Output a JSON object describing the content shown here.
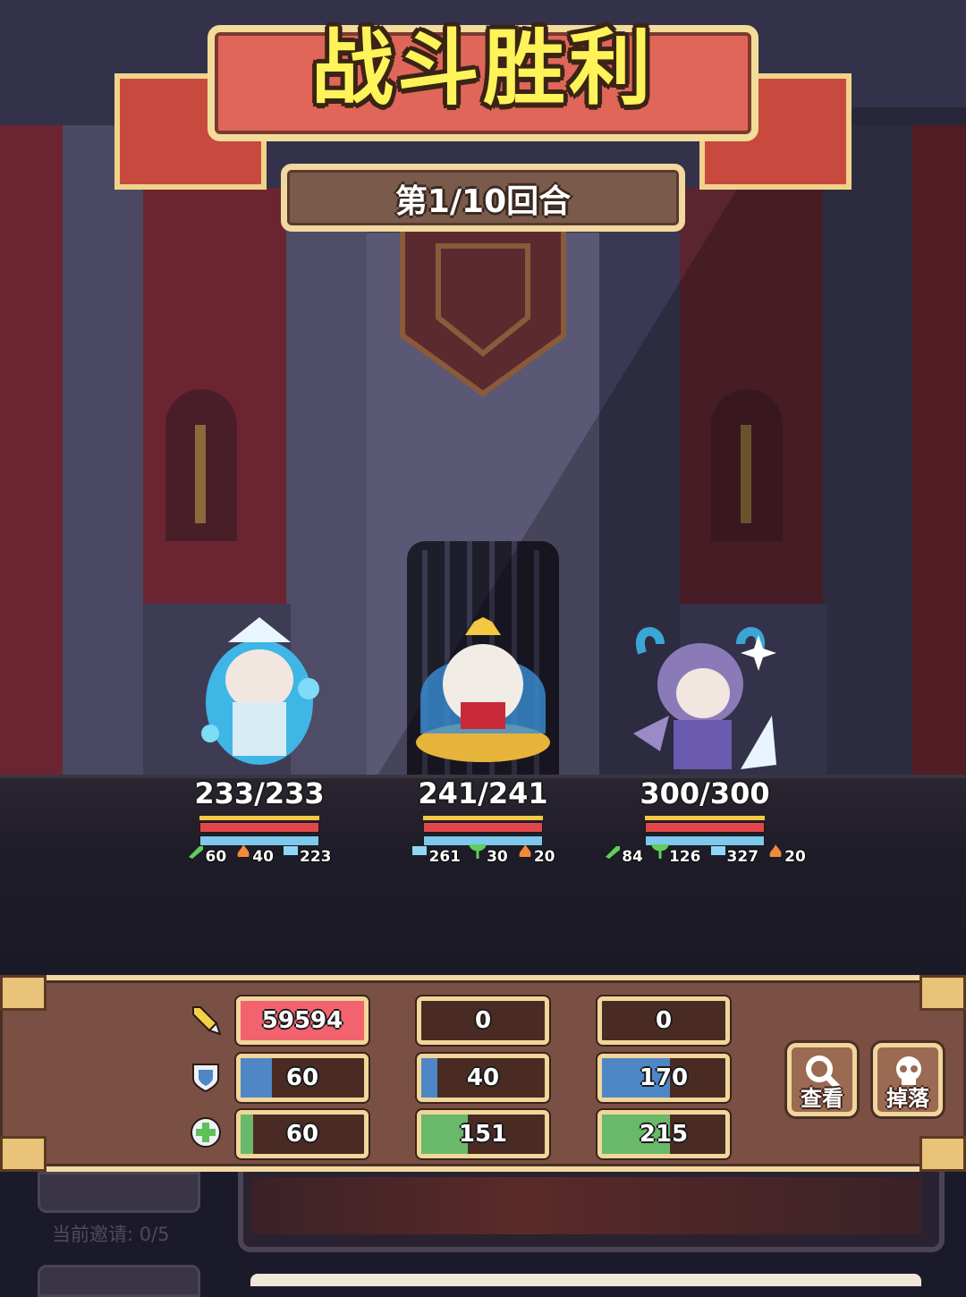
{
  "title": "战斗胜利",
  "round_text": "第1/10回合",
  "heroes": [
    {
      "hp": "233/233",
      "stats": [
        {
          "icon": "sword-icon",
          "value": "60"
        },
        {
          "icon": "fire-icon",
          "value": "40"
        },
        {
          "icon": "shield-icon",
          "value": "223"
        }
      ]
    },
    {
      "hp": "241/241",
      "stats": [
        {
          "icon": "shield-icon",
          "value": "261"
        },
        {
          "icon": "sprout-icon",
          "value": "30"
        },
        {
          "icon": "fire-icon",
          "value": "20"
        }
      ]
    },
    {
      "hp": "300/300",
      "stats": [
        {
          "icon": "sword-icon",
          "value": "84"
        },
        {
          "icon": "sprout-icon",
          "value": "126"
        },
        {
          "icon": "shield-icon",
          "value": "327"
        },
        {
          "icon": "fire-icon",
          "value": "20"
        }
      ]
    }
  ],
  "panel": {
    "rows": [
      {
        "icon": "damage-icon",
        "values": [
          "59594",
          "0",
          "0"
        ],
        "fill_fraction": [
          1.0,
          0,
          0
        ],
        "fill_color": "#f3636f"
      },
      {
        "icon": "defense-icon",
        "values": [
          "60",
          "40",
          "170"
        ],
        "fill_fraction": [
          0.25,
          0.13,
          0.55
        ],
        "fill_color": "#4f86c6"
      },
      {
        "icon": "heal-icon",
        "values": [
          "60",
          "151",
          "215"
        ],
        "fill_fraction": [
          0.1,
          0.38,
          0.55
        ],
        "fill_color": "#6ab96a"
      }
    ],
    "view_button_label": "查看",
    "drop_button_label": "掉落"
  },
  "below": {
    "invite_text": "当前邀请: 0/5"
  },
  "colors": {
    "title_yellow": "#fff35a",
    "banner_red": "#e0665a",
    "panel_brown": "#7a5044",
    "frame_gold": "#f0d69a"
  }
}
